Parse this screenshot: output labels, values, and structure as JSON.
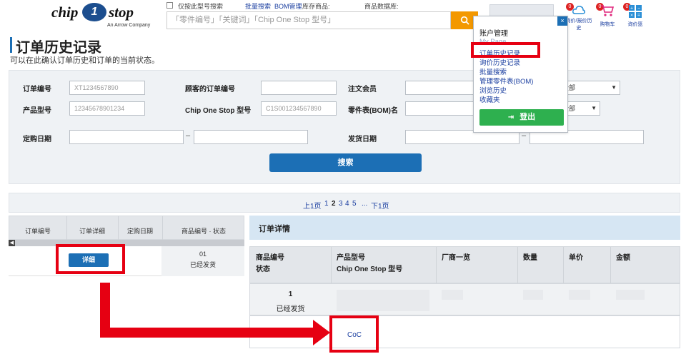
{
  "header": {
    "logo": {
      "name": "chip",
      "one": "1",
      "stop": "stop",
      "tagline": "An Arrow Company"
    },
    "only_model_search": "仅按此型号搜索",
    "links": [
      "批量搜索",
      "BOM管理",
      "库存商品:"
    ],
    "db_label": "商品数据库:",
    "search_placeholder": "「零件编号」「关键词」「Chip One Stop 型号」",
    "icons": [
      {
        "name": "notification",
        "badge": "0",
        "label": "询价/报价历史"
      },
      {
        "name": "cart",
        "badge": "0",
        "label": "购物车"
      },
      {
        "name": "quote",
        "badge": "0",
        "label": "询价篮"
      }
    ]
  },
  "page": {
    "title": "订单历史记录",
    "subtitle": "可以在此确认订单历史和订单的当前状态。"
  },
  "form": {
    "order_no_label": "订单编号",
    "order_no_placeholder": "XT1234567890",
    "customer_order_label": "顾客的订单编号",
    "ordering_member_label": "注文会员",
    "product_model_label": "产品型号",
    "product_model_placeholder": "12345678901234",
    "cos_model_label": "Chip One Stop 型号",
    "cos_model_placeholder": "C1S001234567890",
    "bom_label": "零件表(BOM)名",
    "select_all_1": "全部",
    "select_all_2": "全部",
    "order_date_label": "定购日期",
    "ship_date_label": "发货日期",
    "range_dash": "–",
    "search_button": "搜索"
  },
  "pager": {
    "prev": "上1页",
    "pages": [
      "1",
      "2",
      "3",
      "4",
      "5"
    ],
    "current": "2",
    "ellipsis": "...",
    "next": "下1页"
  },
  "left_table": {
    "columns": [
      "订单编号",
      "订单详细",
      "定购日期",
      "商品编号 · 状态"
    ],
    "row": {
      "detail_button": "详细",
      "item_no": "01",
      "status": "已经发货"
    }
  },
  "detail_panel": {
    "title": "订单详情",
    "columns": [
      {
        "line1": "商品编号",
        "line2": "状态"
      },
      {
        "line1": "产品型号",
        "line2": "Chip One Stop 型号"
      },
      {
        "line1": "厂商一览",
        "line2": ""
      },
      {
        "line1": "数量",
        "line2": ""
      },
      {
        "line1": "单价",
        "line2": ""
      },
      {
        "line1": "金额",
        "line2": ""
      }
    ],
    "row": {
      "item_no": "1",
      "status": "已经发货"
    },
    "coc_link": "CoC"
  },
  "account_popup": {
    "heading": "账户管理",
    "items": [
      "My Page",
      "订单历史记录",
      "询价历史记录",
      "批量搜索",
      "管理零件表(BOM)",
      "浏览历史",
      "收藏夹"
    ],
    "close": "×",
    "logout": "登出"
  },
  "colors": {
    "primary_blue": "#1c6fb5",
    "search_orange": "#f39800",
    "logout_green": "#2eb04f",
    "highlight_red": "#e60012"
  }
}
